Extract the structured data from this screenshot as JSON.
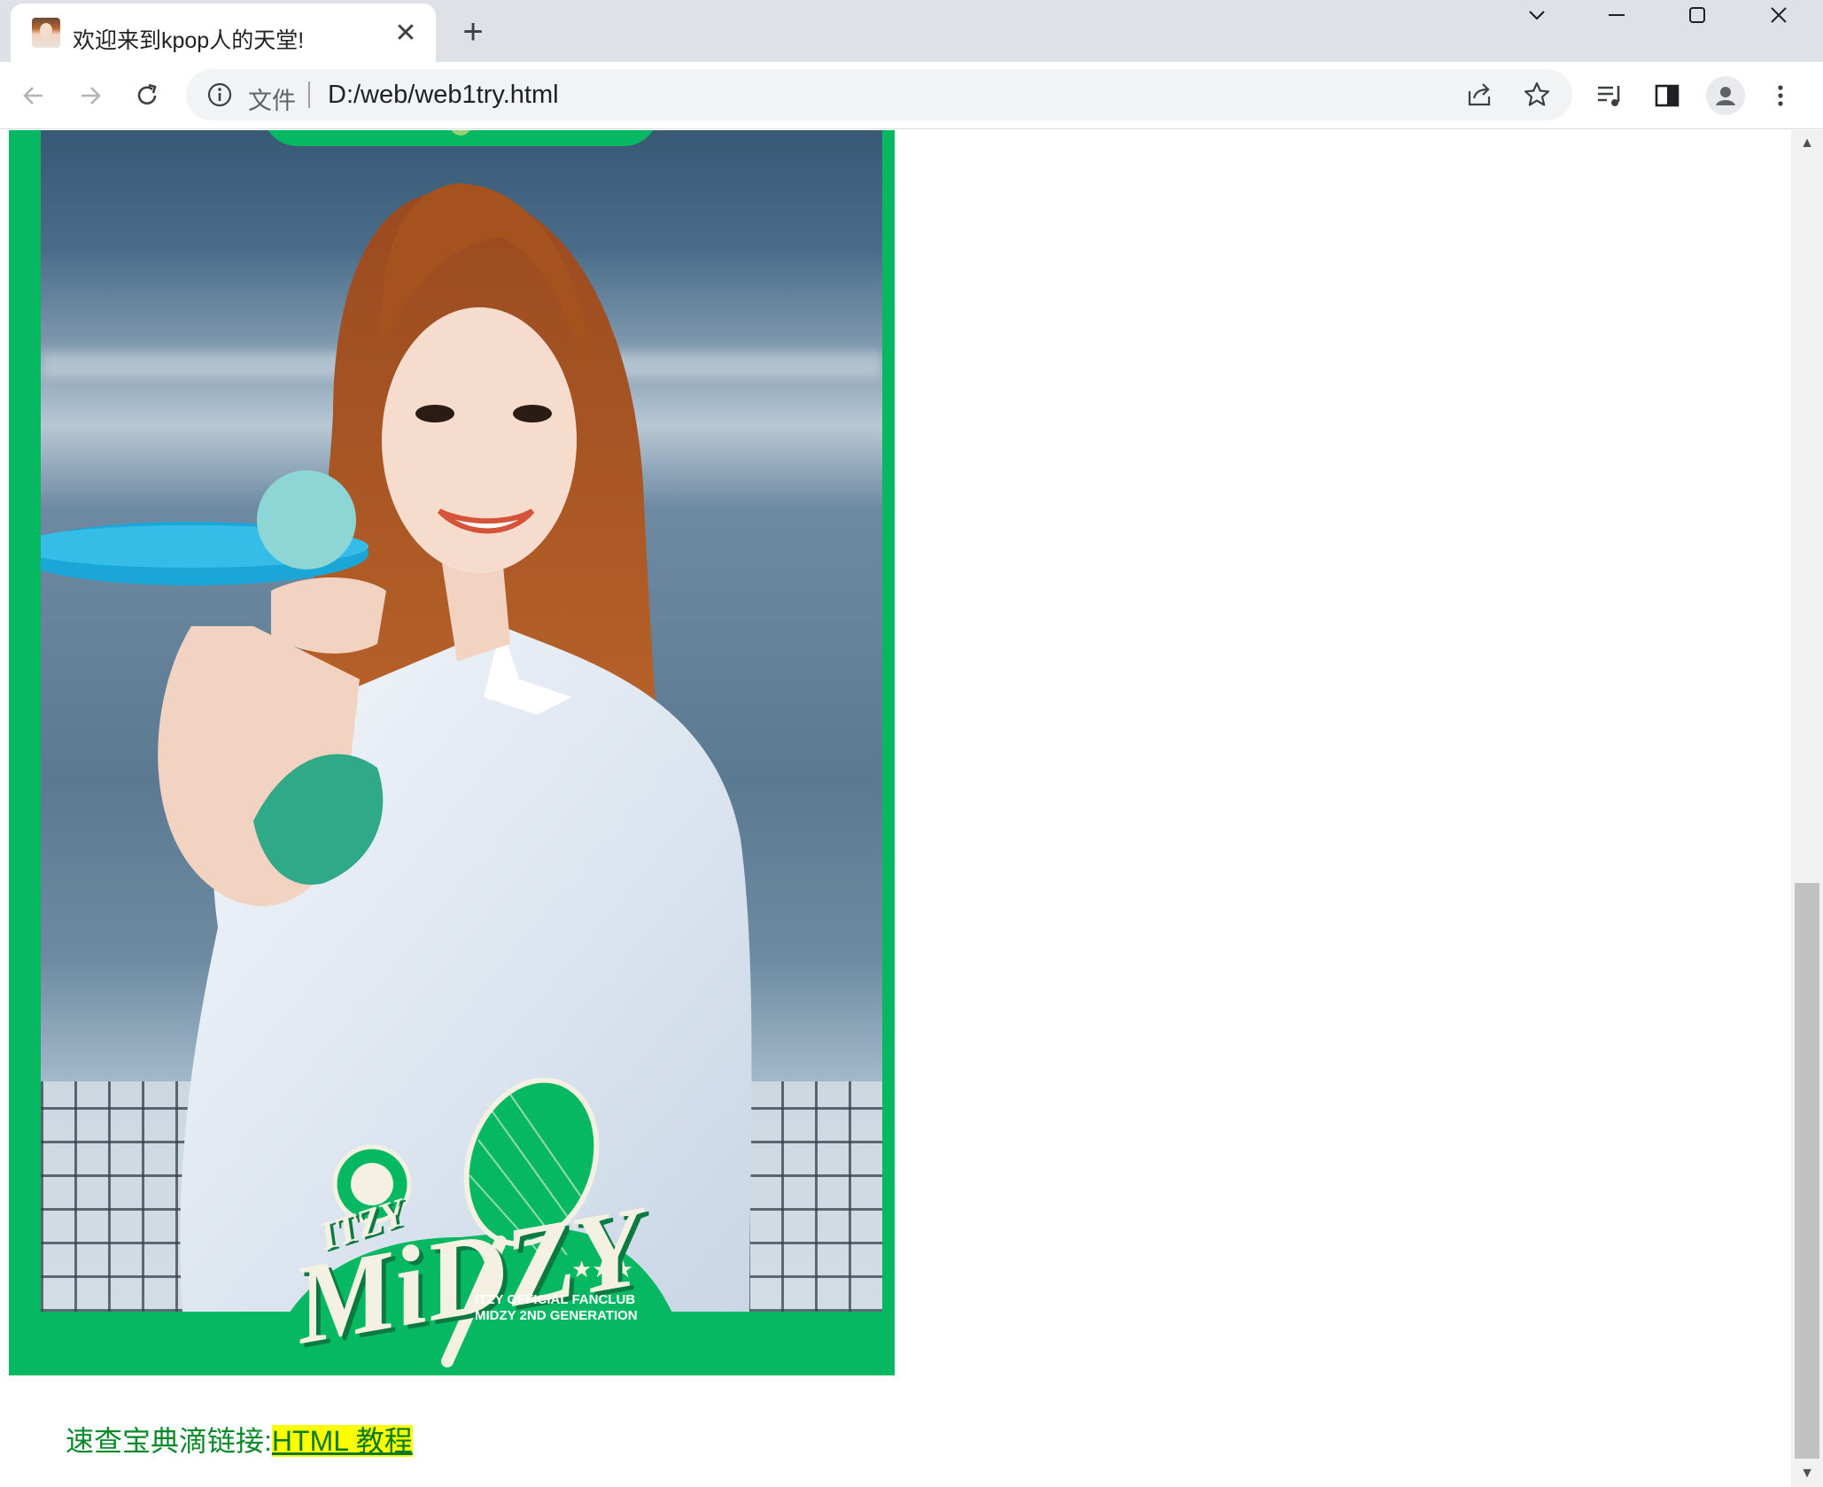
{
  "browser": {
    "tab": {
      "title": "欢迎来到kpop人的天堂!",
      "close": "✕"
    },
    "new_tab": "+",
    "window_controls": {
      "dropdown": "chevron-down-icon",
      "minimize": "minimize-icon",
      "maximize": "maximize-icon",
      "close": "close-icon"
    },
    "address": {
      "scheme_label": "文件",
      "url": "D:/web/web1try.html"
    },
    "toolbar_icons": [
      "back-icon",
      "forward-icon",
      "reload-icon",
      "info-icon",
      "share-icon",
      "star-icon",
      "media-icon",
      "side-panel-icon",
      "profile-icon",
      "menu-icon"
    ]
  },
  "page": {
    "image": {
      "description": "ITZY fanclub photo card with green frame",
      "logo_word": "MiDZY",
      "logo_top_word": "ITZY",
      "caption_line_1": "ITZY OFFICIAL FANCLUB",
      "caption_line_2": "MIDZY 2ND GENERATION"
    },
    "link_prefix": "速查宝典滴链接:",
    "link_text": "HTML 教程"
  },
  "colors": {
    "frame_green": "#07b862",
    "link_highlight": "#ffff00",
    "link_text": "#0a7a22",
    "tabstrip": "#dee1e6"
  }
}
